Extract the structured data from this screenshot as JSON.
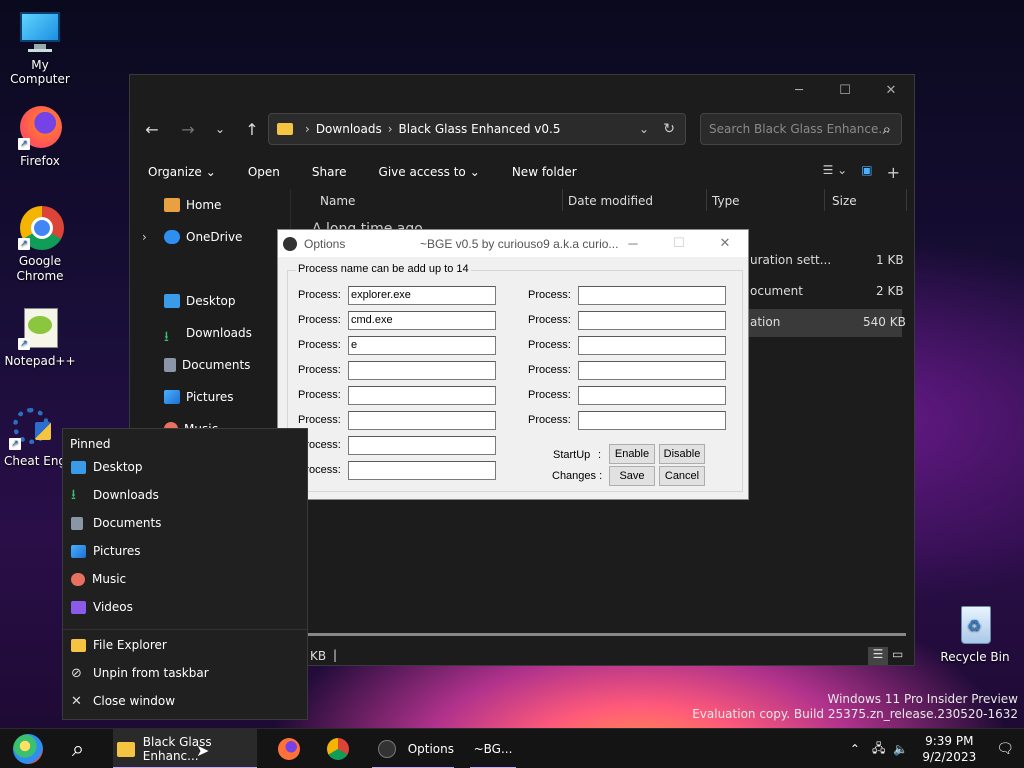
{
  "desktop": {
    "icons": [
      {
        "label": "My Computer"
      },
      {
        "label": "Firefox"
      },
      {
        "label": "Google Chrome"
      },
      {
        "label": "Notepad++"
      },
      {
        "label": "Cheat Engi"
      },
      {
        "label": "Recycle Bin"
      }
    ]
  },
  "explorer": {
    "breadcrumb": [
      "Downloads",
      "Black Glass Enhanced v0.5"
    ],
    "search_placeholder": "Search Black Glass Enhance...",
    "toolbar": [
      "Organize",
      "Open",
      "Share",
      "Give access to",
      "New folder"
    ],
    "sidebar": [
      "Home",
      "OneDrive",
      "Desktop",
      "Downloads",
      "Documents",
      "Pictures",
      "Music"
    ],
    "columns": [
      "Name",
      "Date modified",
      "Type",
      "Size"
    ],
    "group_header": "A long time ago",
    "rows": [
      {
        "type": "uration sett...",
        "size": "1 KB"
      },
      {
        "type": "ocument",
        "size": "2 KB"
      },
      {
        "type": "ation",
        "size": "540 KB"
      }
    ],
    "status": "KB"
  },
  "options": {
    "title": "Options",
    "subtitle": "~BGE v0.5 by curiouso9 a.k.a curio...",
    "group_label": "Process name can be add up to 14",
    "process_label": "Process:",
    "left_values": [
      "explorer.exe",
      "cmd.exe",
      "e",
      "",
      "",
      "",
      "",
      ""
    ],
    "right_values": [
      "",
      "",
      "",
      "",
      "",
      ""
    ],
    "startup_label": "StartUp",
    "changes_label": "Changes :",
    "colon": ":",
    "enable": "Enable",
    "disable": "Disable",
    "save": "Save",
    "cancel": "Cancel"
  },
  "jumplist": {
    "pinned_label": "Pinned",
    "pinned": [
      "Desktop",
      "Downloads",
      "Documents",
      "Pictures",
      "Music",
      "Videos"
    ],
    "tasks": [
      "File Explorer",
      "Unpin from taskbar",
      "Close window"
    ]
  },
  "watermark": {
    "line1": "Windows 11 Pro Insider Preview",
    "line2": "Evaluation copy. Build 25375.zn_release.230520-1632"
  },
  "taskbar": {
    "explorer_label": "Black Glass Enhanc...",
    "options_label": "Options",
    "bge_label": "~BG...",
    "time": "9:39 PM",
    "date": "9/2/2023"
  }
}
